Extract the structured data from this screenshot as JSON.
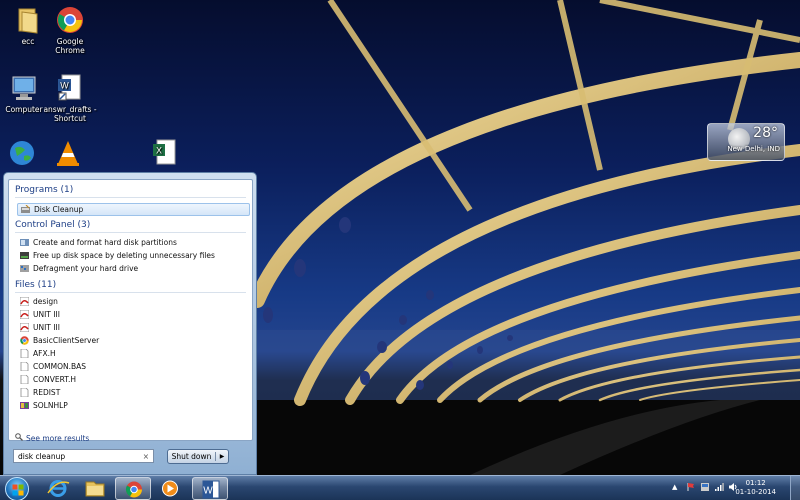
{
  "desktop": {
    "icons": [
      {
        "name": "folder-icon",
        "label": "ecc"
      },
      {
        "name": "chrome-icon",
        "label": "Google Chrome"
      },
      {
        "name": "computer-icon",
        "label": "Computer"
      },
      {
        "name": "word-shortcut-icon",
        "label": "answr_drafts - Shortcut"
      }
    ]
  },
  "weather": {
    "temperature": "28°",
    "location": "New Delhi, IND"
  },
  "start_menu": {
    "programs_header": "Programs (1)",
    "programs": [
      {
        "label": "Disk Cleanup"
      }
    ],
    "control_panel_header": "Control Panel (3)",
    "control_panel": [
      {
        "label": "Create and format hard disk partitions"
      },
      {
        "label": "Free up disk space by deleting unnecessary files"
      },
      {
        "label": "Defragment your hard drive"
      }
    ],
    "files_header": "Files (11)",
    "files": [
      {
        "label": "design",
        "icon": "pdf-icon"
      },
      {
        "label": "UNIT III",
        "icon": "pdf-icon"
      },
      {
        "label": "UNIT III",
        "icon": "pdf-icon"
      },
      {
        "label": "BasicClientServer",
        "icon": "chrome-icon"
      },
      {
        "label": "AFX.H",
        "icon": "file-icon"
      },
      {
        "label": "COMMON.BAS",
        "icon": "file-icon"
      },
      {
        "label": "CONVERT.H",
        "icon": "file-icon"
      },
      {
        "label": "REDIST",
        "icon": "file-icon"
      },
      {
        "label": "SOLNHLP",
        "icon": "file-icon"
      }
    ],
    "see_more": "See more results",
    "search_value": "disk cleanup",
    "search_clear": "×",
    "shutdown_label": "Shut down",
    "shutdown_arrow": "▶"
  },
  "taskbar": {
    "time": "01:12",
    "date": "01-10-2014"
  }
}
